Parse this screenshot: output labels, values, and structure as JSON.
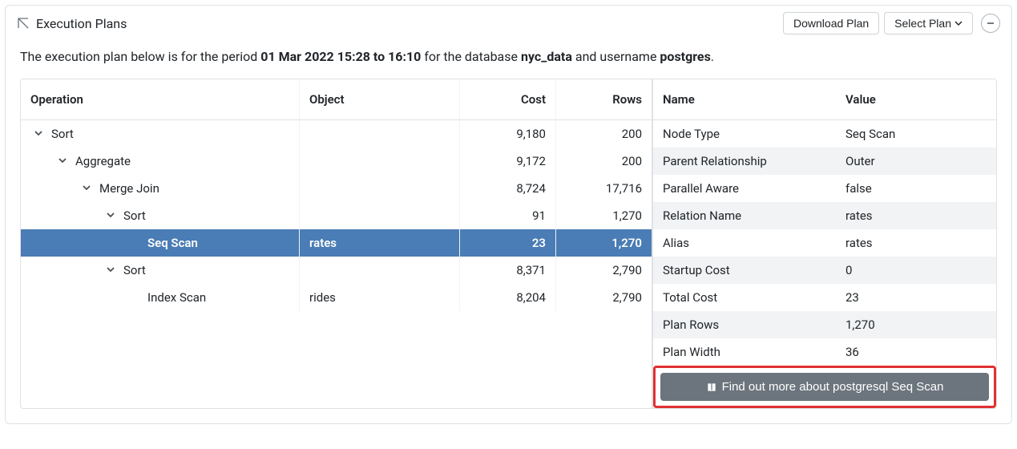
{
  "header": {
    "title": "Execution Plans",
    "download_label": "Download Plan",
    "select_label": "Select Plan"
  },
  "description": {
    "prefix": "The execution plan below is for the period ",
    "period": "01 Mar 2022 15:28 to 16:10",
    "mid1": " for the database ",
    "database": "nyc_data",
    "mid2": " and username ",
    "username": "postgres",
    "suffix": "."
  },
  "plan": {
    "columns": {
      "operation": "Operation",
      "object": "Object",
      "cost": "Cost",
      "rows": "Rows"
    },
    "rows": [
      {
        "indent": 0,
        "op": "Sort",
        "object": "",
        "cost": "9,180",
        "rows": "200",
        "expandable": true,
        "selected": false
      },
      {
        "indent": 1,
        "op": "Aggregate",
        "object": "",
        "cost": "9,172",
        "rows": "200",
        "expandable": true,
        "selected": false
      },
      {
        "indent": 2,
        "op": "Merge Join",
        "object": "",
        "cost": "8,724",
        "rows": "17,716",
        "expandable": true,
        "selected": false
      },
      {
        "indent": 3,
        "op": "Sort",
        "object": "",
        "cost": "91",
        "rows": "1,270",
        "expandable": true,
        "selected": false
      },
      {
        "indent": 4,
        "op": "Seq Scan",
        "object": "rates",
        "cost": "23",
        "rows": "1,270",
        "expandable": false,
        "selected": true
      },
      {
        "indent": 3,
        "op": "Sort",
        "object": "",
        "cost": "8,371",
        "rows": "2,790",
        "expandable": true,
        "selected": false
      },
      {
        "indent": 4,
        "op": "Index Scan",
        "object": "rides",
        "cost": "8,204",
        "rows": "2,790",
        "expandable": false,
        "selected": false
      }
    ]
  },
  "details": {
    "columns": {
      "name": "Name",
      "value": "Value"
    },
    "rows": [
      {
        "name": "Node Type",
        "value": "Seq Scan"
      },
      {
        "name": "Parent Relationship",
        "value": "Outer"
      },
      {
        "name": "Parallel Aware",
        "value": "false"
      },
      {
        "name": "Relation Name",
        "value": "rates"
      },
      {
        "name": "Alias",
        "value": "rates"
      },
      {
        "name": "Startup Cost",
        "value": "0"
      },
      {
        "name": "Total Cost",
        "value": "23"
      },
      {
        "name": "Plan Rows",
        "value": "1,270"
      },
      {
        "name": "Plan Width",
        "value": "36"
      }
    ],
    "more_label": "Find out more about postgresql Seq Scan"
  }
}
